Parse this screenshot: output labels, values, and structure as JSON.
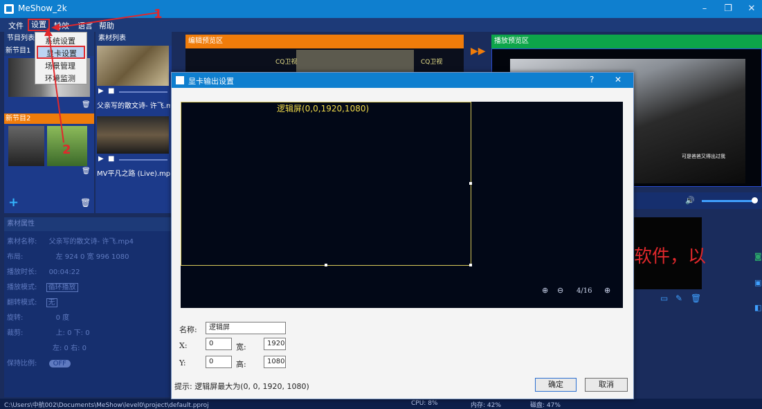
{
  "window": {
    "title": "MeShow_2k",
    "controls": {
      "minimize": "–",
      "maximize": "❐",
      "close": "✕"
    }
  },
  "menu": {
    "file": "文件",
    "settings": "设置",
    "effects": "特效",
    "language": "语言",
    "help": "帮助"
  },
  "settings_dropdown": {
    "items": [
      "系统设置",
      "显卡设置",
      "场景管理",
      "环境监测"
    ],
    "highlighted_index": 1
  },
  "annotations": {
    "step1": "1",
    "step2": "2"
  },
  "program_list": {
    "header": "节目列表",
    "programs": [
      {
        "label": "新节目1"
      },
      {
        "label": "新节目2"
      }
    ],
    "add": "+"
  },
  "media_list": {
    "header": "素材列表",
    "items": [
      {
        "name": "父亲写的散文诗- 许飞.mp4"
      },
      {
        "name": "MV平凡之路 (Live).mp4"
      }
    ]
  },
  "edit_preview": {
    "header": "编辑预览区",
    "channel_logo": "CQ卫视"
  },
  "play_preview": {
    "header": "播放预览区",
    "subtitle": "可是爸爸又得出过我",
    "overlay_text": "软件，以",
    "volume": 1.0
  },
  "properties": {
    "header": "素材属性",
    "rows": [
      {
        "label": "素材名称:",
        "value": "父亲写的散文诗- 许飞.mp4"
      },
      {
        "label": "布局:",
        "value": "左 924   0    宽 996    1080"
      },
      {
        "label": "播放时长:",
        "value": "00:04:22"
      },
      {
        "label": "播放模式:",
        "value": "循环播放"
      },
      {
        "label": "翻转模式:",
        "value": "无"
      },
      {
        "label": "旋转:",
        "value": "0     度"
      },
      {
        "label": "裁剪:",
        "value": "上: 0    下: 0"
      },
      {
        "label": "",
        "value": "左: 0    右: 0"
      },
      {
        "label": "保持比例:",
        "value": "OFF"
      }
    ]
  },
  "status": {
    "path": "C:\\Users\\中航002\\Documents\\MeShow\\level0\\project\\default.pproj",
    "cpu": "CPU: 8%",
    "memory": "内存: 42%",
    "disk": "磁盘: 47%"
  },
  "dialog": {
    "title": "显卡输出设置",
    "help": "?",
    "close": "✕",
    "screen_label": "逻辑屏(0,0,1920,1080)",
    "page_indicator": "4/16",
    "name_label": "名称:",
    "name_value": "逻辑屏",
    "x_label": "X:",
    "x_value": "0",
    "width_label": "宽:",
    "width_value": "1920",
    "y_label": "Y:",
    "y_value": "0",
    "height_label": "高:",
    "height_value": "1080",
    "hint": "提示: 逻辑屏最大为(0, 0, 1920, 1080)",
    "ok": "确定",
    "cancel": "取消"
  },
  "colors": {
    "accent_blue": "#0f7fcf",
    "orange": "#f07c0a",
    "green": "#0da54a",
    "annotation_red": "#e0282c"
  }
}
